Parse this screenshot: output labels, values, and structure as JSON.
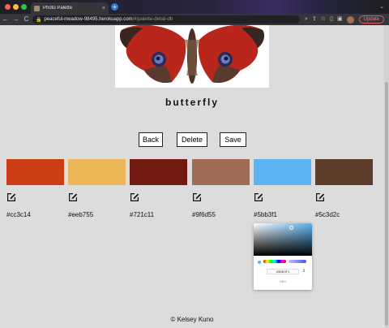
{
  "browser": {
    "tab_title": "Photo Palette",
    "tab_close": "×",
    "new_tab": "+",
    "url_host": "peaceful-meadow-98495.herokuapp.com",
    "url_path": "/#/palette-detail-db",
    "update_label": "Update",
    "back": "←",
    "forward": "→",
    "reload": "C"
  },
  "photo": {
    "title": "butterfly"
  },
  "actions": {
    "back_label": "Back",
    "delete_label": "Delete",
    "save_label": "Save"
  },
  "palette": {
    "colors": [
      {
        "hex": "#cc3c14",
        "color": "#cc3c14"
      },
      {
        "hex": "#eeb755",
        "color": "#eeb755"
      },
      {
        "hex": "#721c11",
        "color": "#721c11"
      },
      {
        "hex": "#9f6d55",
        "color": "#9f6d55"
      },
      {
        "hex": "#5bb3f1",
        "color": "#5bb3f1"
      },
      {
        "hex": "#5c3d2c",
        "color": "#5c3d2c"
      }
    ]
  },
  "picker": {
    "value": "#5BB3F1",
    "mode_label": "HEX"
  },
  "footer": {
    "text": "© Kelsey Kuno"
  }
}
